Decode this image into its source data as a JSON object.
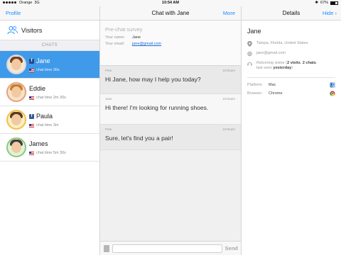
{
  "status": {
    "carrier": "Orange",
    "network": "3G",
    "time": "10:54 AM",
    "battery": "67%"
  },
  "left": {
    "nav_button": "Profile",
    "visitors_label": "Visitors",
    "section_header": "CHATS",
    "chats": [
      {
        "name": "Jane",
        "time": "chat time 30s",
        "facebook": true,
        "active": true
      },
      {
        "name": "Eddie",
        "time": "chat time 2m 30s",
        "facebook": false,
        "active": false
      },
      {
        "name": "Paula",
        "time": "chat time 3m",
        "facebook": true,
        "active": false
      },
      {
        "name": "James",
        "time": "chat time 5m 30s",
        "facebook": false,
        "active": false
      }
    ]
  },
  "middle": {
    "title": "Chat with Jane",
    "more_button": "More",
    "survey": {
      "title": "Pre-chat survey",
      "name_label": "Your name:",
      "name_value": "Jane",
      "email_label": "Your email:",
      "email_value": "jane@gmail.com"
    },
    "messages": [
      {
        "sender": "Pete",
        "time": "10:01am",
        "text": "Hi Jane, how may I help you today?",
        "kind": "operator"
      },
      {
        "sender": "Jane",
        "time": "10:01am",
        "text": "Hi there! I'm looking for running shoes.",
        "kind": "visitor"
      },
      {
        "sender": "Pete",
        "time": "10:01am",
        "text": "Sure, let's find you a pair!",
        "kind": "operator"
      }
    ],
    "composer_placeholder": "",
    "send_button": "Send"
  },
  "right": {
    "title": "Details",
    "hide_button": "Hide",
    "visitor_name": "Jane",
    "location": "Tampa, Florida, United States",
    "email": "jane@gmail.com",
    "returning_prefix": "Returning visitor (",
    "visits": "2 visits",
    "chats": "2 chats",
    "last_seen_prefix": "last seen ",
    "last_seen": "yesterday",
    "platform_label": "Platform:",
    "platform_value": "Mac",
    "browser_label": "Browser:",
    "browser_value": "Chrome"
  },
  "colors": {
    "accent": "#1a8cff",
    "selected_row": "#3f9ae9",
    "facebook": "#3b5998"
  }
}
